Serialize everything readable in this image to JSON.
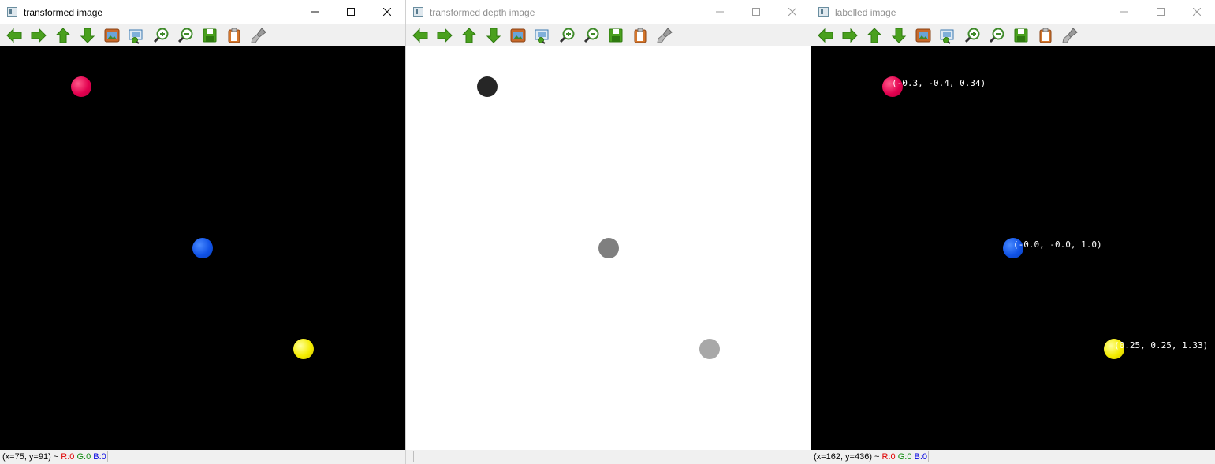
{
  "windows": [
    {
      "title": "transformed image",
      "status": {
        "coords": "(x=75, y=91) ~ ",
        "r": "R:0",
        "g": "G:0",
        "b": "B:0"
      }
    },
    {
      "title": "transformed depth image",
      "status": {
        "coords": "",
        "r": "",
        "g": "",
        "b": ""
      }
    },
    {
      "title": "labelled image",
      "labels": [
        "(-0.3, -0.4, 0.34)",
        "(-0.0, -0.0, 1.0)",
        "(0.25, 0.25, 1.33)"
      ],
      "status": {
        "coords": "(x=162, y=436) ~ ",
        "r": "R:0",
        "g": "G:0",
        "b": "B:0"
      }
    }
  ],
  "toolbar_icons": [
    "pan-left-icon",
    "pan-right-icon",
    "pan-up-icon",
    "pan-down-icon",
    "zoom-to-fit-icon",
    "zoom-region-icon",
    "zoom-in-icon",
    "zoom-out-icon",
    "save-icon",
    "copy-to-clipboard-icon",
    "properties-brush-icon"
  ],
  "colors": {
    "ball_red": "#e2004f",
    "ball_blue": "#1052e6",
    "ball_yellow": "#f4ec00",
    "toolbar_green": "#4aa01e"
  }
}
